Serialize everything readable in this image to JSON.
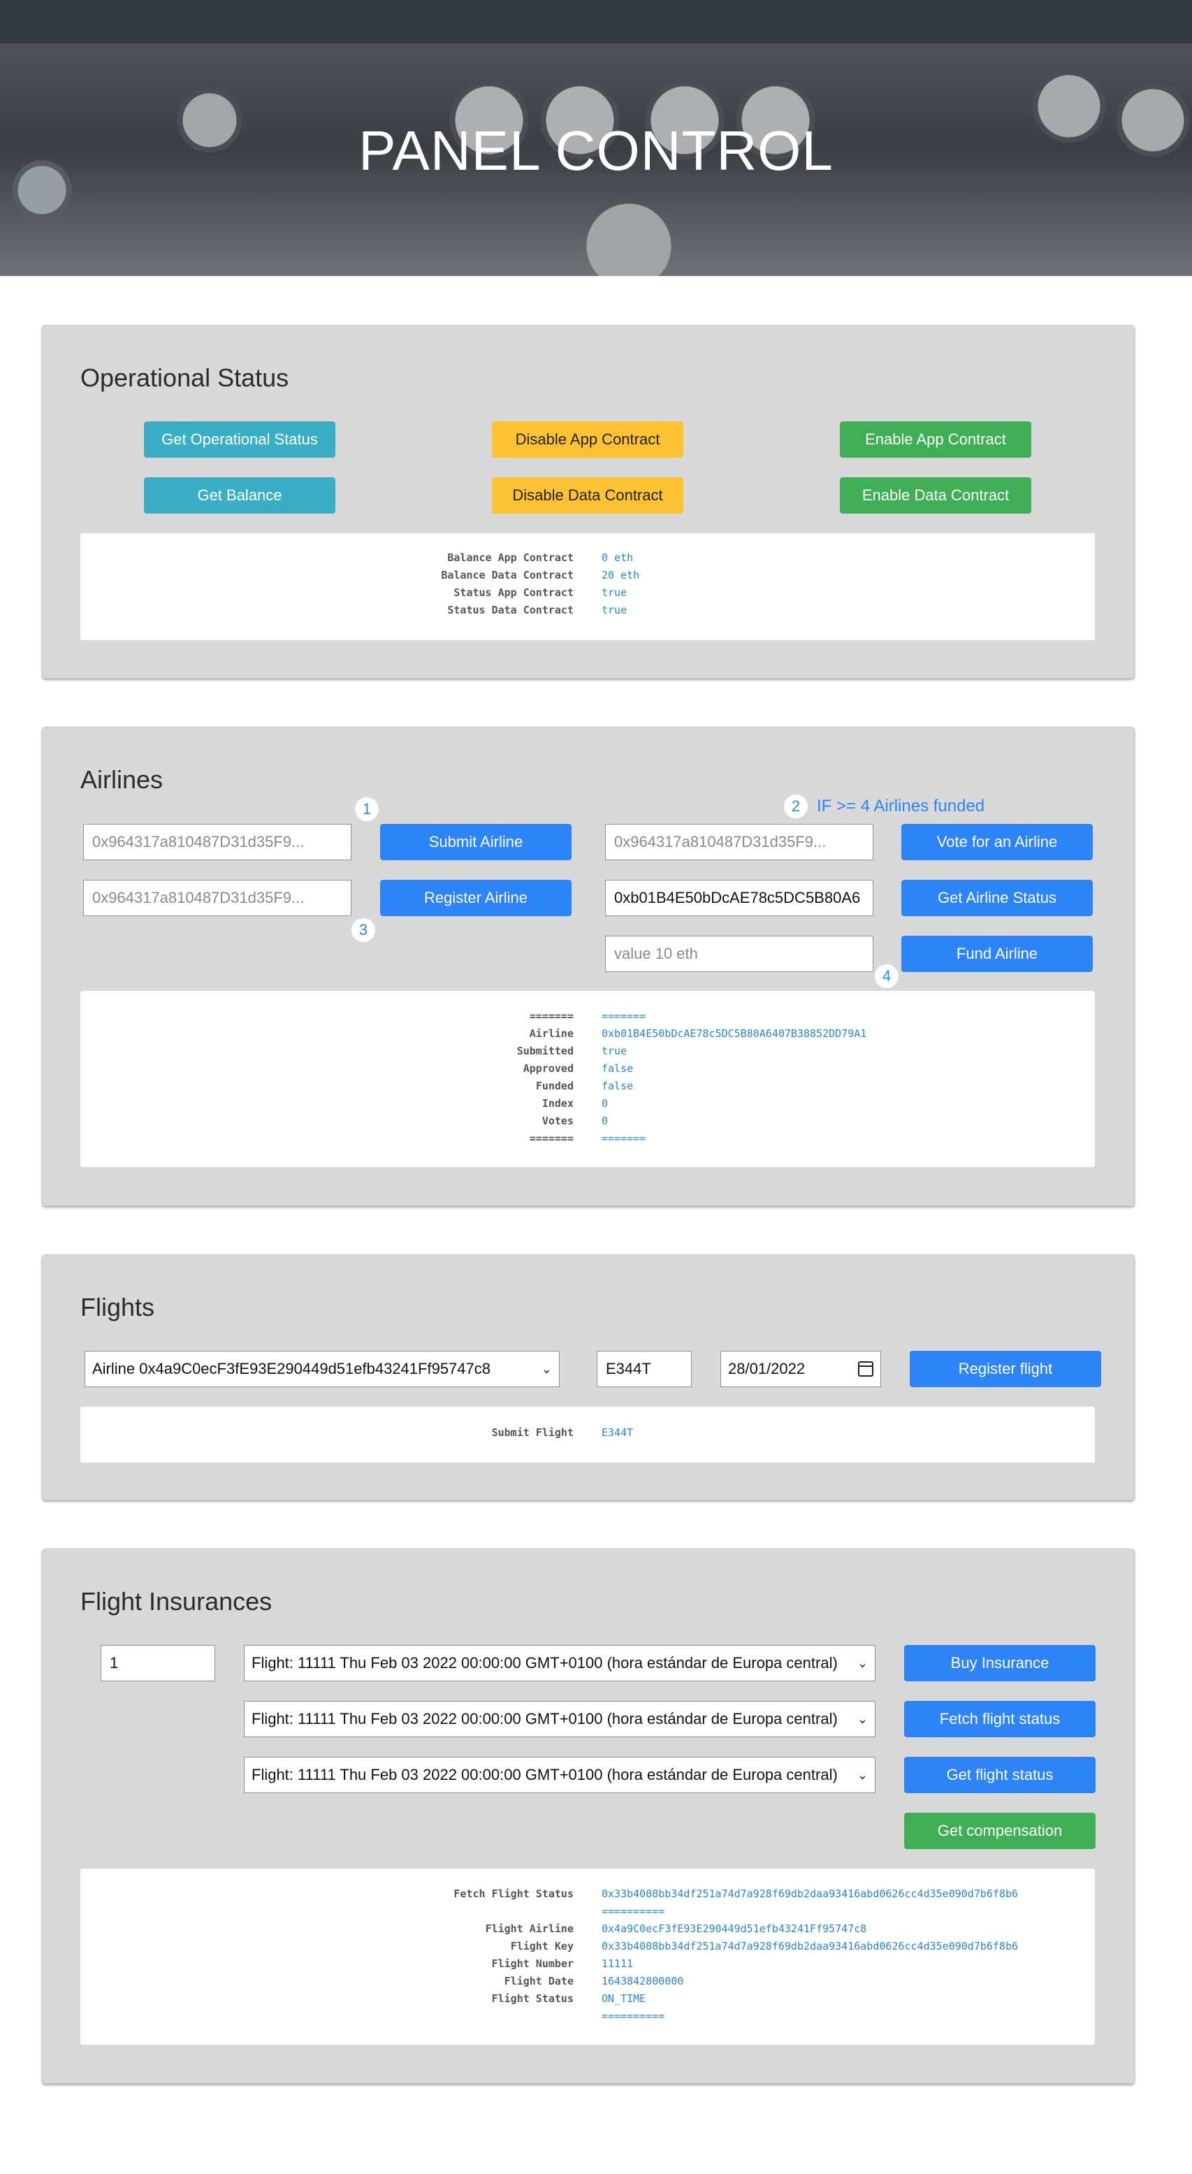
{
  "hero": {
    "title": "PANEL CONTROL"
  },
  "operational": {
    "title": "Operational Status",
    "buttons": {
      "get_status": "Get Operational Status",
      "disable_app": "Disable App Contract",
      "enable_app": "Enable App Contract",
      "get_balance": "Get Balance",
      "disable_data": "Disable Data Contract",
      "enable_data": "Enable Data Contract"
    },
    "output": [
      {
        "key": "Balance App Contract",
        "value": "0 eth"
      },
      {
        "key": "Balance Data Contract",
        "value": "20 eth"
      },
      {
        "key": "Status App Contract",
        "value": "true"
      },
      {
        "key": "Status Data Contract",
        "value": "true"
      }
    ]
  },
  "airlines": {
    "title": "Airlines",
    "badges": {
      "b1": "1",
      "b2": "2",
      "b3": "3",
      "b4": "4"
    },
    "note": "IF >= 4 Airlines funded",
    "inputs": {
      "submit_placeholder": "0x964317a810487D31d35F9...",
      "register_placeholder": "0x964317a810487D31d35F9...",
      "vote_placeholder": "0x964317a810487D31d35F9...",
      "status_value": "0xb01B4E50bDcAE78c5DC5B80A6",
      "fund_placeholder": "value 10 eth"
    },
    "buttons": {
      "submit": "Submit Airline",
      "register": "Register Airline",
      "vote": "Vote for an Airline",
      "status": "Get Airline Status",
      "fund": "Fund Airline"
    },
    "output": [
      {
        "key": "=======",
        "value": "======="
      },
      {
        "key": "Airline",
        "value": "0xb01B4E50bDcAE78c5DC5B80A6407B38852DD79A1"
      },
      {
        "key": "Submitted",
        "value": "true"
      },
      {
        "key": "Approved",
        "value": "false"
      },
      {
        "key": "Funded",
        "value": "false"
      },
      {
        "key": "Index",
        "value": "0"
      },
      {
        "key": "Votes",
        "value": "0"
      },
      {
        "key": "=======",
        "value": "======="
      }
    ]
  },
  "flights": {
    "title": "Flights",
    "airline_select": "Airline 0x4a9C0ecF3fE93E290449d51efb43241Ff95747c8",
    "flight_number": "E344T",
    "date": "28/01/2022",
    "register_button": "Register flight",
    "output": [
      {
        "key": "Submit Flight",
        "value": "E344T"
      }
    ]
  },
  "insurances": {
    "title": "Flight Insurances",
    "amount": "1",
    "flight_select_1": "Flight: 11111 Thu Feb 03 2022 00:00:00 GMT+0100 (hora estándar de Europa central)",
    "flight_select_2": "Flight: 11111 Thu Feb 03 2022 00:00:00 GMT+0100 (hora estándar de Europa central)",
    "flight_select_3": "Flight: 11111 Thu Feb 03 2022 00:00:00 GMT+0100 (hora estándar de Europa central)",
    "buttons": {
      "buy": "Buy Insurance",
      "fetch": "Fetch flight status",
      "get": "Get flight status",
      "compensation": "Get compensation"
    },
    "output": [
      {
        "key": "Fetch Flight Status",
        "value": "0x33b4008bb34df251a74d7a928f69db2daa93416abd0626cc4d35e090d7b6f8b6"
      },
      {
        "key": "",
        "value": "=========="
      },
      {
        "key": "Flight Airline",
        "value": "0x4a9C0ecF3fE93E290449d51efb43241Ff95747c8"
      },
      {
        "key": "Flight Key",
        "value": "0x33b4008bb34df251a74d7a928f69db2daa93416abd0626cc4d35e090d7b6f8b6"
      },
      {
        "key": "Flight Number",
        "value": "11111"
      },
      {
        "key": "Flight Date",
        "value": "1643842800000"
      },
      {
        "key": "Flight Status",
        "value": "ON_TIME"
      },
      {
        "key": "",
        "value": "=========="
      }
    ]
  }
}
